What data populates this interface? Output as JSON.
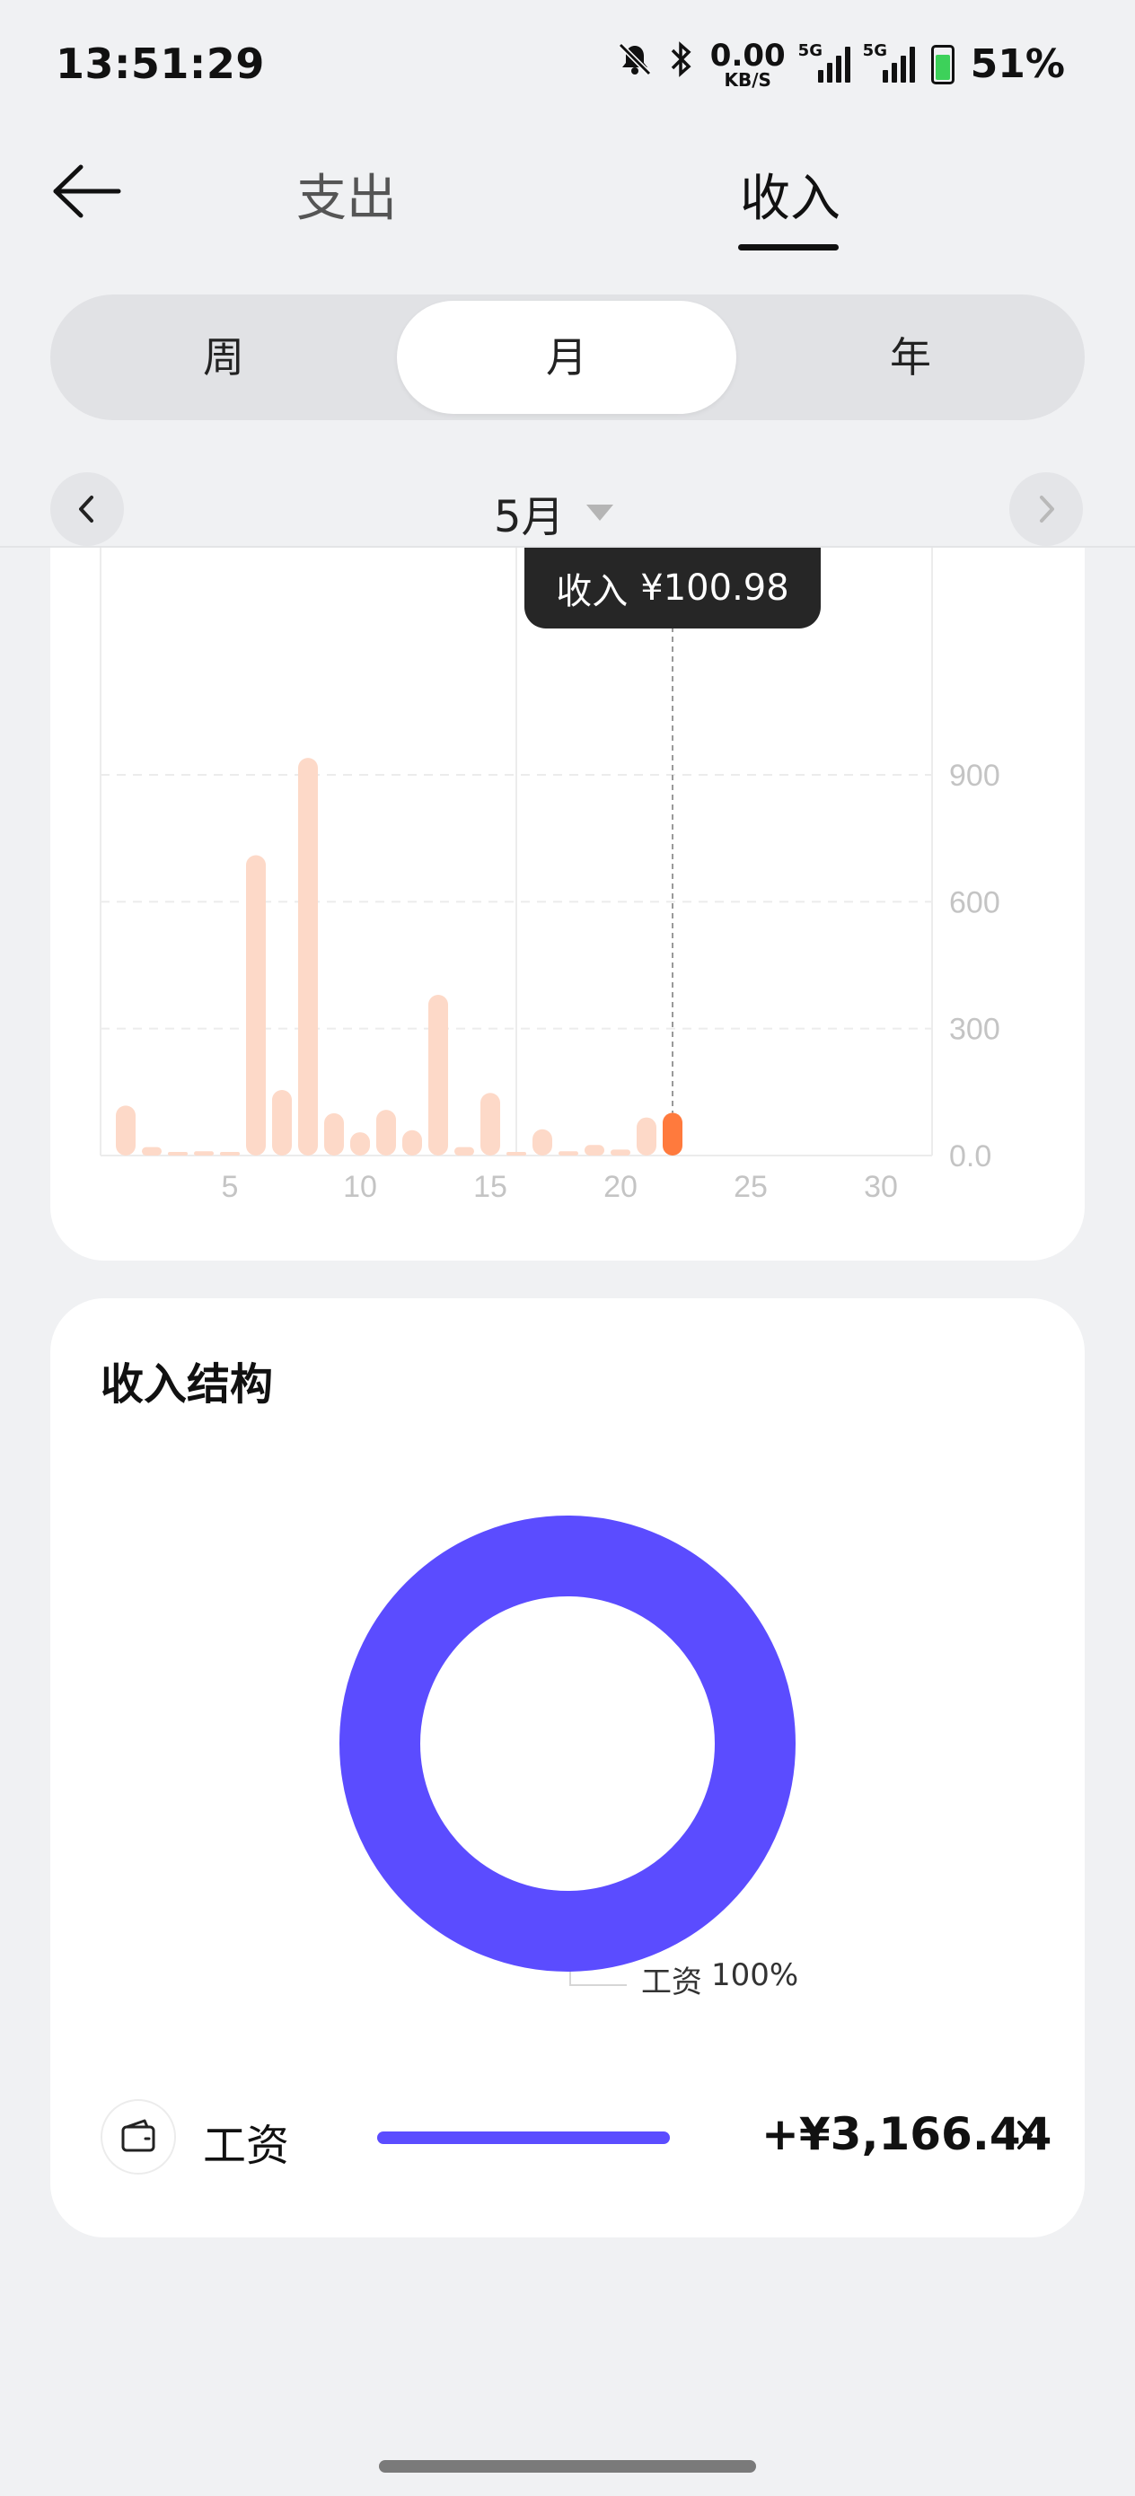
{
  "status_bar": {
    "time": "13:51:29",
    "net_speed_value": "0.00",
    "net_speed_unit": "KB/S",
    "signal1_label": "5G",
    "signal2_label": "5G",
    "battery": "51%",
    "icons": [
      "mute-bell-icon",
      "bluetooth-icon",
      "signal-icon",
      "battery-charging-icon"
    ]
  },
  "header": {
    "tabs": [
      {
        "label": "支出",
        "active": false
      },
      {
        "label": "收入",
        "active": true
      }
    ]
  },
  "period_segment": {
    "options": [
      "周",
      "月",
      "年"
    ],
    "selected": "月"
  },
  "month_selector": {
    "label": "5月"
  },
  "tooltip": {
    "label": "收入",
    "value": "¥100.98"
  },
  "chart_data": {
    "type": "bar",
    "x": [
      1,
      2,
      3,
      4,
      5,
      6,
      7,
      8,
      9,
      10,
      11,
      12,
      13,
      14,
      15,
      16,
      17,
      18,
      19,
      20,
      21,
      22,
      23,
      24,
      25,
      26,
      27,
      28,
      29,
      30,
      31
    ],
    "values": [
      118,
      20,
      6,
      10,
      4,
      710,
      155,
      940,
      100,
      55,
      108,
      60,
      380,
      20,
      148,
      4,
      62,
      10,
      25,
      14,
      90,
      100.98,
      0,
      0,
      0,
      0,
      0,
      0,
      0,
      0,
      0
    ],
    "highlight_index": 21,
    "x_ticks": [
      "5",
      "10",
      "15",
      "20",
      "25",
      "30"
    ],
    "y_ticks": [
      "0.0",
      "300",
      "600",
      "900"
    ],
    "ylim": [
      0,
      1100
    ],
    "colors": {
      "bar": "#fdd9c8",
      "highlight": "#ff7a3d",
      "grid": "#ececec",
      "tick_text": "#c4c4c4",
      "cursor": "#999999"
    }
  },
  "structure": {
    "title": "收入结构",
    "donut": {
      "slices": [
        {
          "label": "工资",
          "percent": 100,
          "color": "#5b4cff"
        }
      ]
    },
    "legend": {
      "name": "工资",
      "percent": "100%"
    },
    "items": [
      {
        "icon": "wallet-icon",
        "name": "工资",
        "amount": "+¥3,166.44",
        "share": 1.0
      }
    ]
  }
}
